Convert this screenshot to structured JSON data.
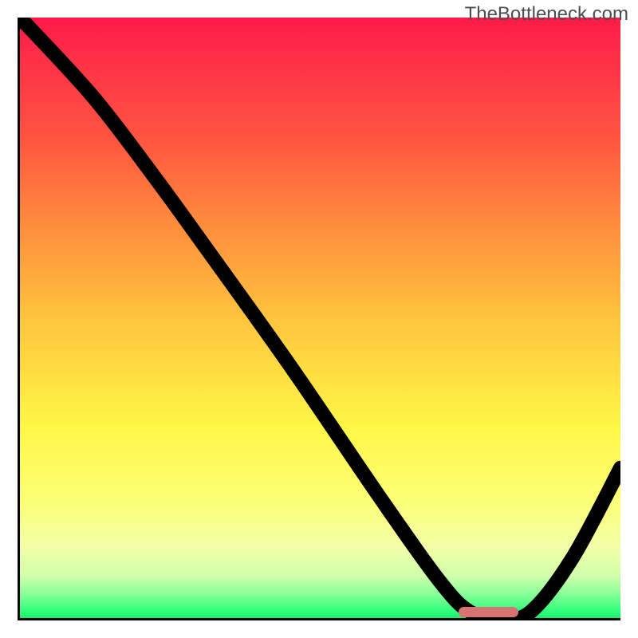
{
  "watermark": "TheBottleneck.com",
  "colors": {
    "curve": "#000000",
    "marker": "#d87373",
    "axis": "#000000"
  },
  "chart_data": {
    "type": "line",
    "title": "",
    "xlabel": "",
    "ylabel": "",
    "xlim": [
      0,
      100
    ],
    "ylim": [
      0,
      100
    ],
    "x": [
      0,
      12,
      22,
      30,
      45,
      60,
      70,
      75,
      80,
      85,
      92,
      100
    ],
    "y": [
      100,
      87,
      74,
      63,
      42,
      20,
      6,
      1,
      0,
      1,
      10,
      25
    ],
    "optimal_range_x": [
      73,
      83
    ],
    "source": "TheBottleneck.com"
  }
}
